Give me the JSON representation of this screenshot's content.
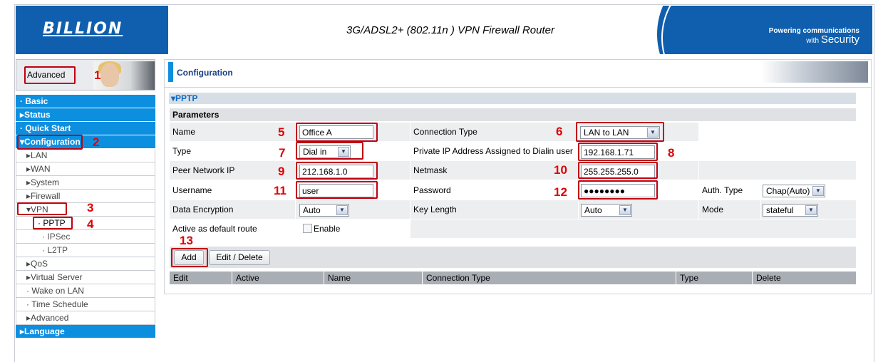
{
  "header": {
    "logo": "BILLION",
    "title": "3G/ADSL2+ (802.11n ) VPN Firewall Router",
    "tagline_top": "Powering communications",
    "tagline_bottom_small": "with",
    "tagline_bottom": "Security"
  },
  "panel": {
    "label": "Advanced"
  },
  "sidebar": {
    "items": [
      {
        "label": "· Basic"
      },
      {
        "label": "▸Status"
      },
      {
        "label": "· Quick Start"
      },
      {
        "label": "▾Configuration"
      },
      {
        "label": "▸LAN"
      },
      {
        "label": "▸WAN"
      },
      {
        "label": "▸System"
      },
      {
        "label": "▸Firewall"
      },
      {
        "label": "▾VPN"
      },
      {
        "label": "· PPTP"
      },
      {
        "label": "· IPSec"
      },
      {
        "label": "· L2TP"
      },
      {
        "label": "▸QoS"
      },
      {
        "label": "▸Virtual Server"
      },
      {
        "label": "· Wake on LAN"
      },
      {
        "label": "· Time Schedule"
      },
      {
        "label": "▸Advanced"
      },
      {
        "label": "▸Language"
      }
    ]
  },
  "content": {
    "title": "Configuration",
    "section": "▾PPTP",
    "params_label": "Parameters",
    "form": {
      "name_label": "Name",
      "name_value": "Office A",
      "conn_type_label": "Connection Type",
      "conn_type_value": "LAN to LAN",
      "type_label": "Type",
      "type_value": "Dial in",
      "private_ip_label": "Private IP Address Assigned to Dialin user",
      "private_ip_value": "192.168.1.71",
      "peer_ip_label": "Peer Network IP",
      "peer_ip_value": "212.168.1.0",
      "netmask_label": "Netmask",
      "netmask_value": "255.255.255.0",
      "username_label": "Username",
      "username_value": "user",
      "password_label": "Password",
      "password_value": "●●●●●●●●",
      "auth_label": "Auth. Type",
      "auth_value": "Chap(Auto)",
      "encryption_label": "Data Encryption",
      "encryption_value": "Auto",
      "keylen_label": "Key Length",
      "keylen_value": "Auto",
      "mode_label": "Mode",
      "mode_value": "stateful",
      "default_route_label": "Active as default route",
      "enable_label": "Enable"
    },
    "buttons": {
      "add": "Add",
      "edit_delete": "Edit / Delete"
    },
    "table_headers": [
      "Edit",
      "Active",
      "Name",
      "Connection Type",
      "Type",
      "Delete"
    ]
  },
  "annotations": [
    "1",
    "2",
    "3",
    "4",
    "5",
    "6",
    "7",
    "8",
    "9",
    "10",
    "11",
    "12",
    "13"
  ],
  "colors": {
    "brand_blue": "#0f5fae",
    "menu_blue": "#0d8fe0",
    "annotation_red": "#e00000"
  }
}
